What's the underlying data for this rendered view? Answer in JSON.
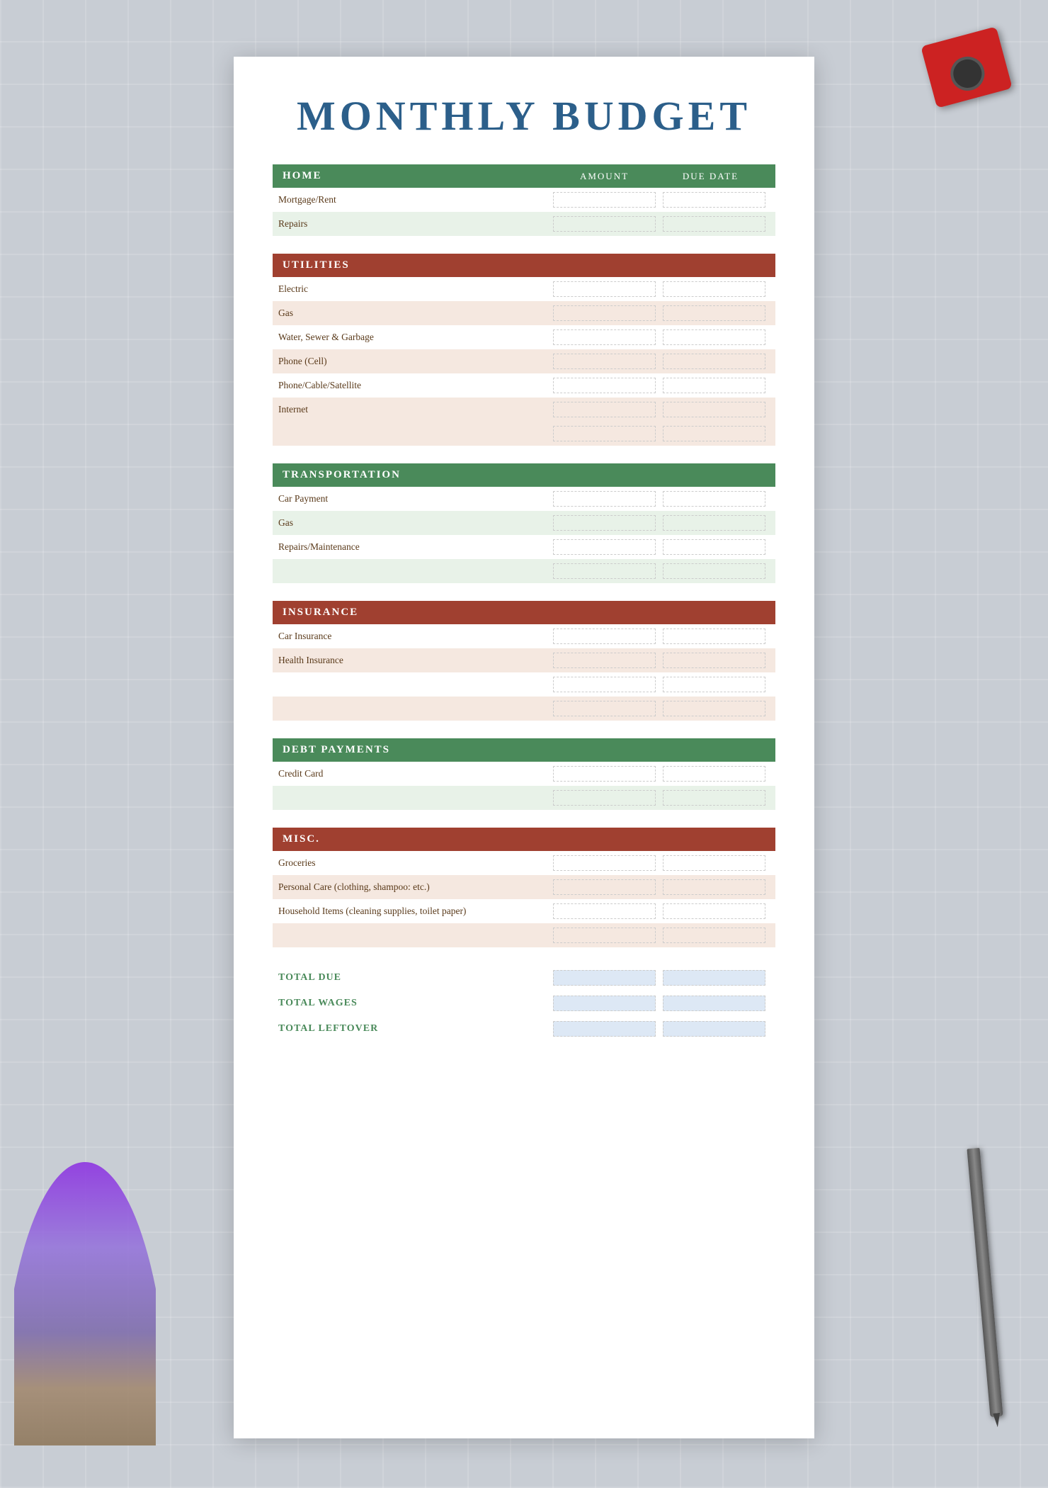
{
  "page": {
    "title": "MONTHLY BUDGET"
  },
  "columns": {
    "amount": "Amount",
    "dueDate": "Due Date"
  },
  "sections": [
    {
      "id": "home",
      "label": "HOME",
      "color": "green",
      "rows": [
        {
          "label": "Mortgage/Rent",
          "shaded": false
        },
        {
          "label": "Repairs",
          "shaded": true
        }
      ]
    },
    {
      "id": "utilities",
      "label": "UTILITIES",
      "color": "brown",
      "rows": [
        {
          "label": "Electric",
          "shaded": false
        },
        {
          "label": "Gas",
          "shaded": true
        },
        {
          "label": "Water, Sewer & Garbage",
          "shaded": false
        },
        {
          "label": "Phone (Cell)",
          "shaded": true
        },
        {
          "label": "Phone/Cable/Satellite",
          "shaded": false
        },
        {
          "label": "Internet",
          "shaded": true
        },
        {
          "label": "",
          "shaded": true
        }
      ]
    },
    {
      "id": "transportation",
      "label": "TRANSPORTATION",
      "color": "green",
      "rows": [
        {
          "label": "Car Payment",
          "shaded": false
        },
        {
          "label": "Gas",
          "shaded": true
        },
        {
          "label": "Repairs/Maintenance",
          "shaded": false
        },
        {
          "label": "",
          "shaded": true
        }
      ]
    },
    {
      "id": "insurance",
      "label": "INSURANCE",
      "color": "brown",
      "rows": [
        {
          "label": "Car Insurance",
          "shaded": false
        },
        {
          "label": "Health Insurance",
          "shaded": true
        },
        {
          "label": "",
          "shaded": false
        },
        {
          "label": "",
          "shaded": true
        }
      ]
    },
    {
      "id": "debt",
      "label": "DEBT PAYMENTS",
      "color": "green",
      "rows": [
        {
          "label": "Credit Card",
          "shaded": false
        },
        {
          "label": "",
          "shaded": true
        }
      ]
    },
    {
      "id": "misc",
      "label": "MISC.",
      "color": "brown",
      "rows": [
        {
          "label": "Groceries",
          "shaded": false
        },
        {
          "label": "Personal Care (clothing, shampoo: etc.)",
          "shaded": true
        },
        {
          "label": "Household Items (cleaning supplies, toilet paper)",
          "shaded": false
        },
        {
          "label": "",
          "shaded": true
        }
      ]
    }
  ],
  "totals": [
    {
      "id": "total-due",
      "label": "TOTAL DUE"
    },
    {
      "id": "total-wages",
      "label": "TOTAL WAGES"
    },
    {
      "id": "total-leftover",
      "label": "TOTAL LEFTOVER"
    }
  ]
}
